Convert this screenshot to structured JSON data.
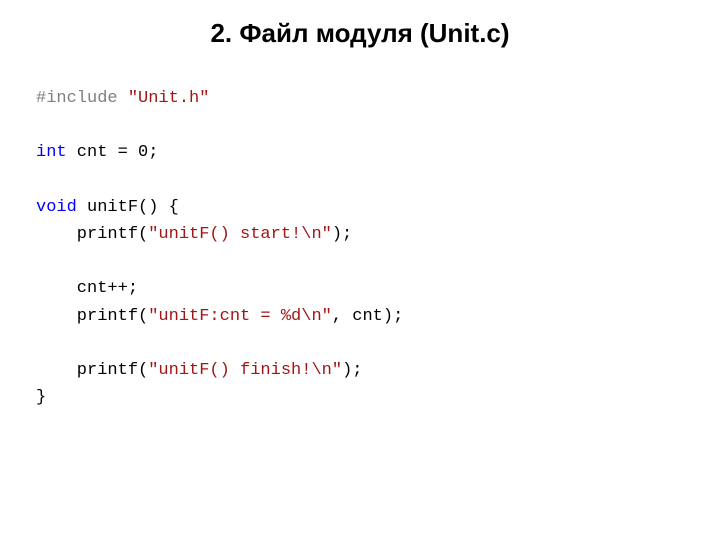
{
  "title": "2. Файл модуля (Unit.c)",
  "code": {
    "l1": {
      "a": "#include",
      "b": " ",
      "c": "\"Unit.h\""
    },
    "l2": "",
    "l3": {
      "a": "int",
      "b": " cnt = 0;"
    },
    "l4": "",
    "l5": {
      "a": "void",
      "b": " unitF() {"
    },
    "l6": {
      "a": "    printf(",
      "b": "\"unitF() start!\\n\"",
      "c": ");"
    },
    "l7": "",
    "l8": "    cnt++;",
    "l9": {
      "a": "    printf(",
      "b": "\"unitF:cnt = %d\\n\"",
      "c": ", cnt);"
    },
    "l10": "",
    "l11": {
      "a": "    printf(",
      "b": "\"unitF() finish!\\n\"",
      "c": ");"
    },
    "l12": "}"
  }
}
